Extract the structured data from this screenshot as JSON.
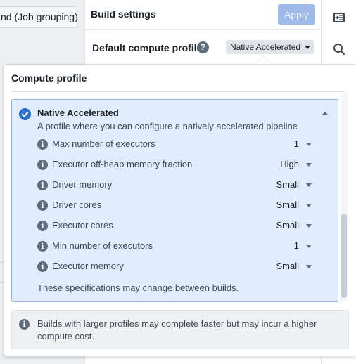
{
  "background": {
    "job_grouping_button": "nd (Job grouping)"
  },
  "build_settings": {
    "title": "Build settings",
    "apply_label": "Apply",
    "default_profile_label": "Default compute profile",
    "help_icon": "question-icon",
    "selected_profile": "Native Accelerated"
  },
  "right_sidebar": {
    "icons": [
      "panel-expand-icon",
      "search-icon"
    ]
  },
  "popover": {
    "title": "Compute profile",
    "profile": {
      "name": "Native Accelerated",
      "description": "A profile where you can configure a natively accelerated pipeline",
      "selected": true,
      "expanded": true,
      "specs": [
        {
          "label": "Max number of executors",
          "value": "1"
        },
        {
          "label": "Executor off-heap memory fraction",
          "value": "High"
        },
        {
          "label": "Driver memory",
          "value": "Small"
        },
        {
          "label": "Driver cores",
          "value": "Small"
        },
        {
          "label": "Executor cores",
          "value": "Small"
        },
        {
          "label": "Min number of executors",
          "value": "1"
        },
        {
          "label": "Executor memory",
          "value": "Small"
        }
      ],
      "note": "These specifications may change between builds."
    },
    "callout": "Builds with larger profiles may complete faster but may incur a higher compute cost."
  },
  "colors": {
    "accent": "#2d72d2",
    "apply_disabled": "#9ebbea",
    "card_bg": "#e1ecfc",
    "card_border": "#8fb3e8"
  }
}
